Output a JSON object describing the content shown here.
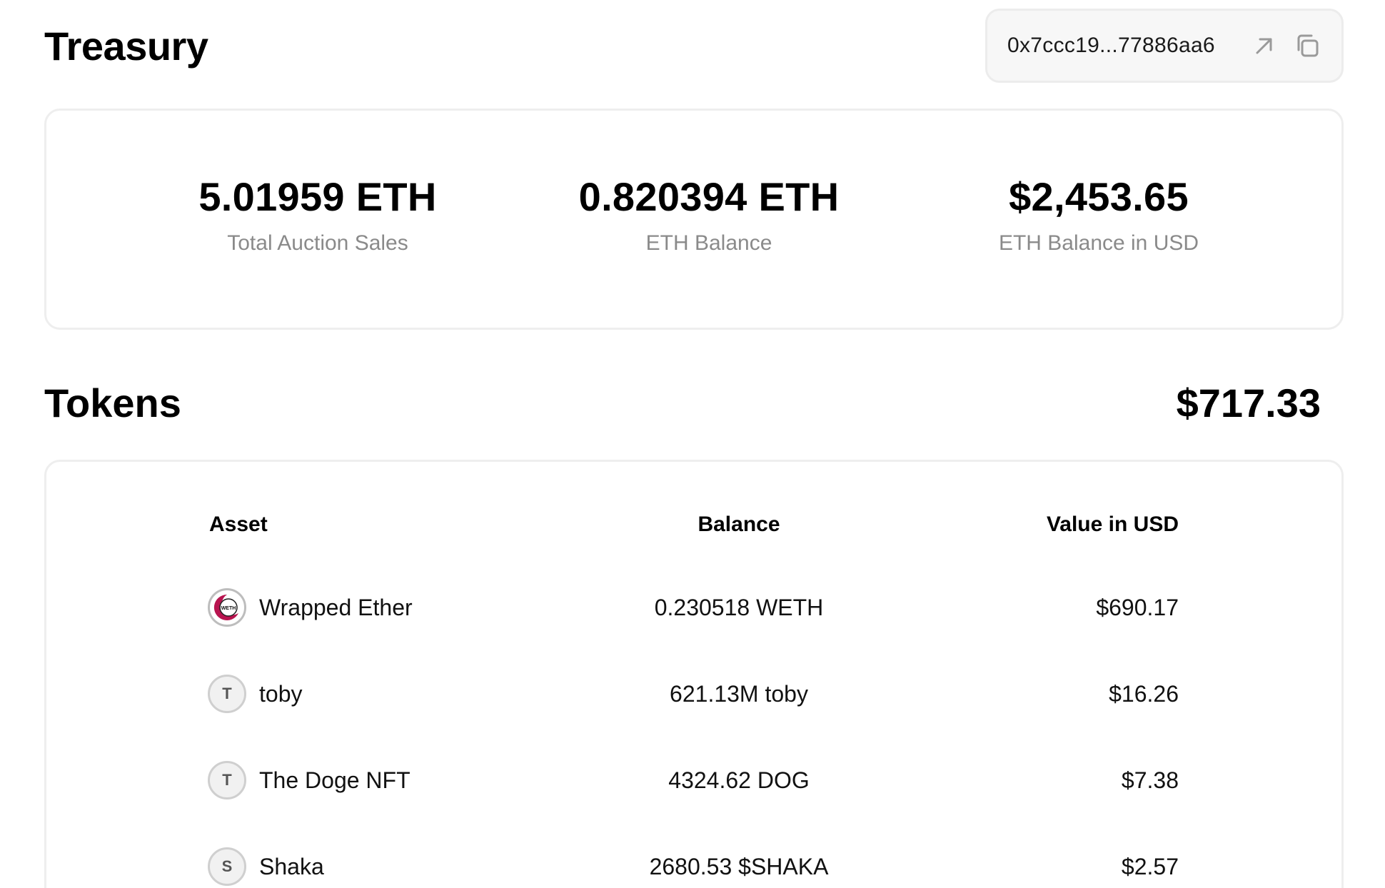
{
  "treasury": {
    "title": "Treasury",
    "address": "0x7ccc19...77886aa6",
    "open_icon": "arrow-up-right-icon",
    "copy_icon": "copy-icon"
  },
  "stats": [
    {
      "value": "5.01959 ETH",
      "label": "Total Auction Sales"
    },
    {
      "value": "0.820394 ETH",
      "label": "ETH Balance"
    },
    {
      "value": "$2,453.65",
      "label": "ETH Balance in USD"
    }
  ],
  "tokens": {
    "title": "Tokens",
    "total": "$717.33",
    "columns": {
      "asset": "Asset",
      "balance": "Balance",
      "value": "Value in USD"
    },
    "rows": [
      {
        "icon": "WETH",
        "name": "Wrapped Ether",
        "balance": "0.230518 WETH",
        "value": "$690.17"
      },
      {
        "icon": "T",
        "name": "toby",
        "balance": "621.13M toby",
        "value": "$16.26"
      },
      {
        "icon": "T",
        "name": "The Doge NFT",
        "balance": "4324.62 DOG",
        "value": "$7.38"
      },
      {
        "icon": "S",
        "name": "Shaka",
        "balance": "2680.53 $SHAKA",
        "value": "$2.57"
      }
    ]
  },
  "colors": {
    "card_border": "#eeeeee",
    "muted_text": "#8a8a8a",
    "weth_accent": "#b8144f"
  }
}
